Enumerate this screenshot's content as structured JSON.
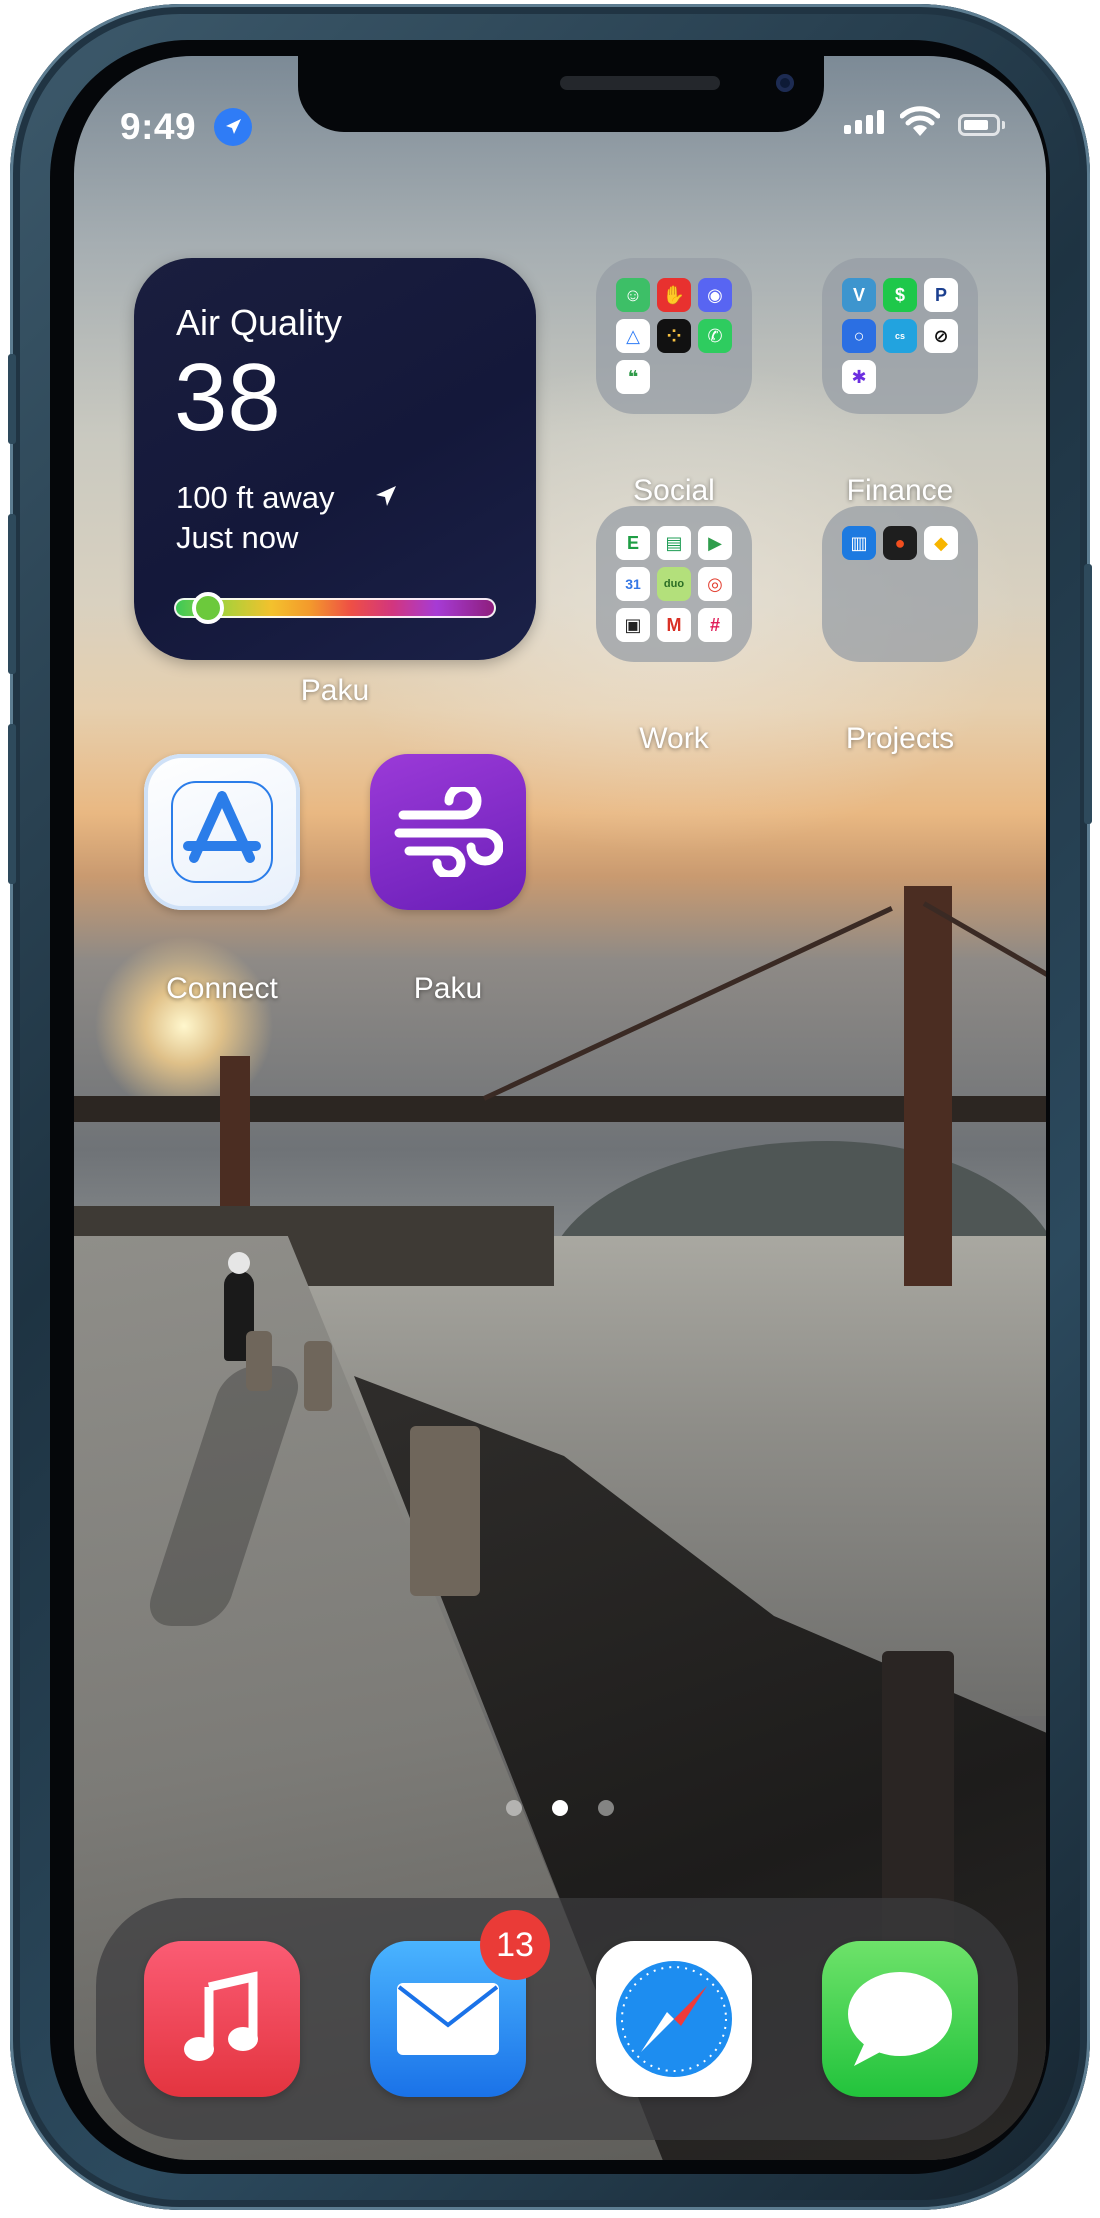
{
  "status_bar": {
    "time": "9:49",
    "location_icon": "location-arrow-icon",
    "signal_icon": "cellular-signal-icon",
    "wifi_icon": "wifi-icon",
    "battery_icon": "battery-icon"
  },
  "widget": {
    "title": "Air Quality",
    "value": "38",
    "distance": "100 ft away",
    "updated": "Just now",
    "label": "Paku",
    "scale_level": 0.1,
    "colors": {
      "background": "#14183a",
      "indicator": "#6cc93c"
    }
  },
  "folders": [
    {
      "name": "Social",
      "apps": [
        "chat-app-icon",
        "hand-wave-icon",
        "discord-icon",
        "delta-icon",
        "dots-app-icon",
        "whatsapp-icon",
        "quote-chat-icon"
      ]
    },
    {
      "name": "Finance",
      "apps": [
        "venmo-icon",
        "cash-app-icon",
        "paypal-icon",
        "ring-app-icon",
        "schwab-icon",
        "slash-app-icon",
        "asterisk-app-icon"
      ]
    },
    {
      "name": "Work",
      "apps": [
        "evernote-icon",
        "sheets-icon",
        "meet-icon",
        "calendar-icon",
        "duo-icon",
        "chrome-icon",
        "square-app-icon",
        "gmail-icon",
        "slack-icon"
      ]
    },
    {
      "name": "Projects",
      "apps": [
        "trello-icon",
        "figma-icon",
        "sketch-icon"
      ]
    }
  ],
  "apps": [
    {
      "name": "Connect",
      "icon": "app-store-connect-icon"
    },
    {
      "name": "Paku",
      "icon": "wind-icon"
    }
  ],
  "page_dots": {
    "count": 3,
    "active_index": 1
  },
  "dock": [
    {
      "icon": "music-icon"
    },
    {
      "icon": "mail-icon",
      "badge": "13"
    },
    {
      "icon": "safari-icon"
    },
    {
      "icon": "messages-icon"
    }
  ]
}
